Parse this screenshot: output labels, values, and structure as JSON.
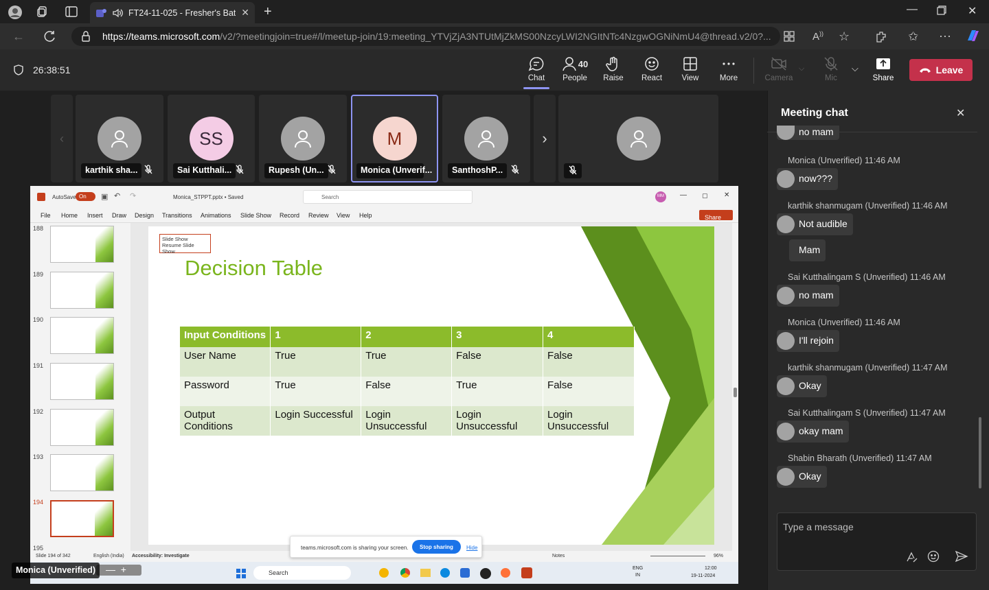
{
  "browser": {
    "tab_title": "FT24-11-025 - Fresher's Batc",
    "url_host": "https://teams.microsoft.com",
    "url_path": "/v2/?meetingjoin=true#/l/meetup-join/19:meeting_YTVjZjA3NTUtMjZkMS00NzcyLWI2NGItNTc4NzgwOGNiNmU4@thread.v2/0?..."
  },
  "meeting": {
    "timer": "26:38:51",
    "people_count": "40"
  },
  "toolbar": {
    "chat": "Chat",
    "people": "People",
    "raise": "Raise",
    "react": "React",
    "view": "View",
    "more": "More",
    "camera": "Camera",
    "mic": "Mic",
    "share": "Share",
    "leave": "Leave"
  },
  "participants": [
    {
      "name": "karthik sha...",
      "initials": ""
    },
    {
      "name": "Sai Kutthali...",
      "initials": "SS"
    },
    {
      "name": "Rupesh (Un...",
      "initials": ""
    },
    {
      "name": "Monica (Unverif...",
      "initials": "M"
    },
    {
      "name": "SanthoshP...",
      "initials": ""
    },
    {
      "name": "",
      "initials": ""
    }
  ],
  "ppt": {
    "autosave": "AutoSave",
    "autosave_state": "On",
    "filename": "Monica_STPPT.pptx • Saved",
    "search": "Search",
    "share": "Share",
    "user_initials": "MM",
    "tabs": [
      "File",
      "Home",
      "Insert",
      "Draw",
      "Design",
      "Transitions",
      "Animations",
      "Slide Show",
      "Record",
      "Review",
      "View",
      "Help"
    ],
    "thumbs": [
      "188",
      "189",
      "190",
      "191",
      "192",
      "193",
      "194",
      "195"
    ],
    "slideshow_label": "Slide Show",
    "resume": "Resume Slide Show",
    "slide_title": "Decision Table",
    "table": {
      "header": [
        "Input Conditions",
        "1",
        "2",
        "3",
        "4"
      ],
      "rows": [
        [
          "User Name",
          "True",
          "True",
          "False",
          "False"
        ],
        [
          "Password",
          "True",
          "False",
          "True",
          "False"
        ],
        [
          "Output Conditions",
          "Login Successful",
          "Login Unsuccessful",
          "Login Unsuccessful",
          "Login Unsuccessful"
        ]
      ]
    },
    "status_slide": "Slide 194 of 342",
    "status_lang": "English (India)",
    "status_access": "Accessibility: Investigate",
    "status_notes": "Notes",
    "zoom": "96%",
    "sharing_text": "teams.microsoft.com is sharing your screen.",
    "stop_sharing": "Stop sharing",
    "hide": "Hide",
    "taskbar_search": "Search",
    "lang": "ENG",
    "region": "IN",
    "clock_time": "12:00",
    "clock_date": "19-11-2024"
  },
  "self_name": "Monica (Unverified)",
  "chat": {
    "title": "Meeting chat",
    "placeholder": "Type a message",
    "messages": [
      {
        "sender": "",
        "text": "no mam"
      },
      {
        "sender": "Monica (Unverified)  11:46 AM",
        "text": "now???"
      },
      {
        "sender": "karthik shanmugam (Unverified)  11:46 AM",
        "text": "Not audible"
      },
      {
        "sender": "",
        "text": "Mam"
      },
      {
        "sender": "Sai Kutthalingam S (Unverified)  11:46 AM",
        "text": "no mam"
      },
      {
        "sender": "Monica (Unverified)  11:46 AM",
        "text": "I'll rejoin"
      },
      {
        "sender": "karthik shanmugam (Unverified)  11:47 AM",
        "text": "Okay"
      },
      {
        "sender": "Sai Kutthalingam S (Unverified)  11:47 AM",
        "text": "okay mam"
      },
      {
        "sender": "Shabin Bharath (Unverified)  11:47 AM",
        "text": "Okay"
      }
    ]
  },
  "colors": {
    "leave": "#c4314b",
    "accent": "#8e94f2",
    "slide_green": "#7ab51d"
  }
}
